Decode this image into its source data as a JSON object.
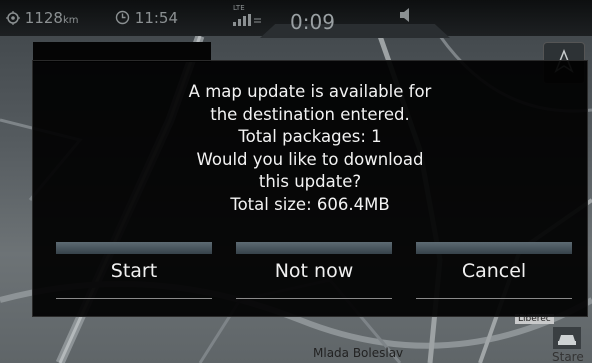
{
  "status_bar": {
    "odometer_value": "1128",
    "odometer_unit": "km",
    "clock": "11:54",
    "network": "LTE",
    "timer": "0:09",
    "icons": [
      "gps-icon",
      "clock-icon",
      "signal-icon",
      "mute-icon"
    ]
  },
  "map": {
    "city_label": "Mlada Boleslav",
    "partial_label": "Stare",
    "ribbon_label": "Liberec"
  },
  "dialog": {
    "message_lines": [
      "A map update is available for",
      "the destination entered.",
      "Total packages: 1",
      "Would you like to download",
      "this update?",
      "Total size: 606.4MB"
    ],
    "buttons": {
      "start": "Start",
      "not_now": "Not now",
      "cancel": "Cancel"
    }
  },
  "colors": {
    "button_accent": "#5d6b73",
    "dialog_bg": "#000000",
    "text": "#f3f3f3"
  }
}
